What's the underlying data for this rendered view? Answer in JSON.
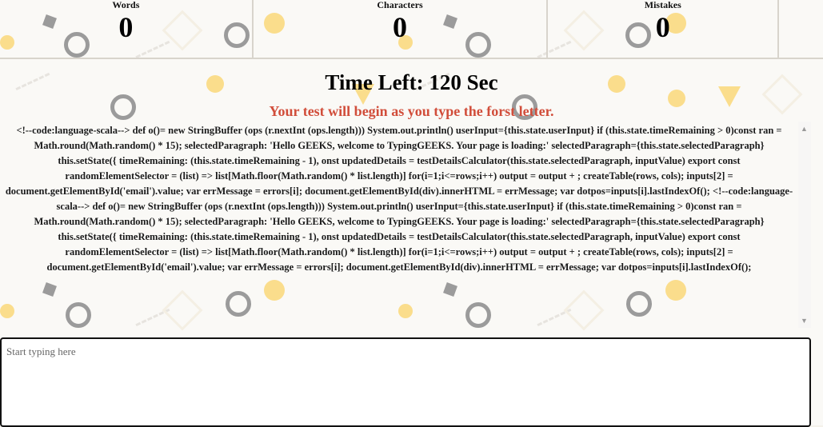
{
  "stats": [
    {
      "label": "Words",
      "value": "0"
    },
    {
      "label": "Characters",
      "value": "0"
    },
    {
      "label": "Mistakes",
      "value": "0"
    }
  ],
  "timer": {
    "prefix": "Time Left: ",
    "seconds": "120",
    "unit": " Sec"
  },
  "notice": "Your test will begin as you type the forst letter.",
  "paragraph": "<!--code:language-scala--> def o()= new StringBuffer (ops (r.nextInt (ops.length))) System.out.println() userInput={this.state.userInput} if (this.state.timeRemaining > 0)const ran = Math.round(Math.random() * 15); selectedParagraph: 'Hello GEEKS, welcome to TypingGEEKS. Your page is loading:' selectedParagraph={this.state.selectedParagraph} this.setState({ timeRemaining: (this.state.timeRemaining - 1), onst updatedDetails = testDetailsCalculator(this.state.selectedParagraph, inputValue) export const randomElementSelector = (list) => list[Math.floor(Math.random() * list.length)] for(i=1;i<=rows;i++) output = output + ; createTable(rows, cols); inputs[2] = document.getElementById('email').value; var errMessage = errors[i]; document.getElementById(div).innerHTML = errMessage; var dotpos=inputs[i].lastIndexOf(); <!--code:language-scala--> def o()= new StringBuffer (ops (r.nextInt (ops.length))) System.out.println() userInput={this.state.userInput} if (this.state.timeRemaining > 0)const ran = Math.round(Math.random() * 15); selectedParagraph: 'Hello GEEKS, welcome to TypingGEEKS. Your page is loading:' selectedParagraph={this.state.selectedParagraph} this.setState({ timeRemaining: (this.state.timeRemaining - 1), onst updatedDetails = testDetailsCalculator(this.state.selectedParagraph, inputValue) export const randomElementSelector = (list) => list[Math.floor(Math.random() * list.length)] for(i=1;i<=rows;i++) output = output + ; createTable(rows, cols); inputs[2] = document.getElementById('email').value; var errMessage = errors[i]; document.getElementById(div).innerHTML = errMessage; var dotpos=inputs[i].lastIndexOf();",
  "input": {
    "placeholder": "Start typing here",
    "value": ""
  },
  "colors": {
    "accent": "#f4b400",
    "notice": "#d14d3a",
    "ink": "#222222"
  }
}
